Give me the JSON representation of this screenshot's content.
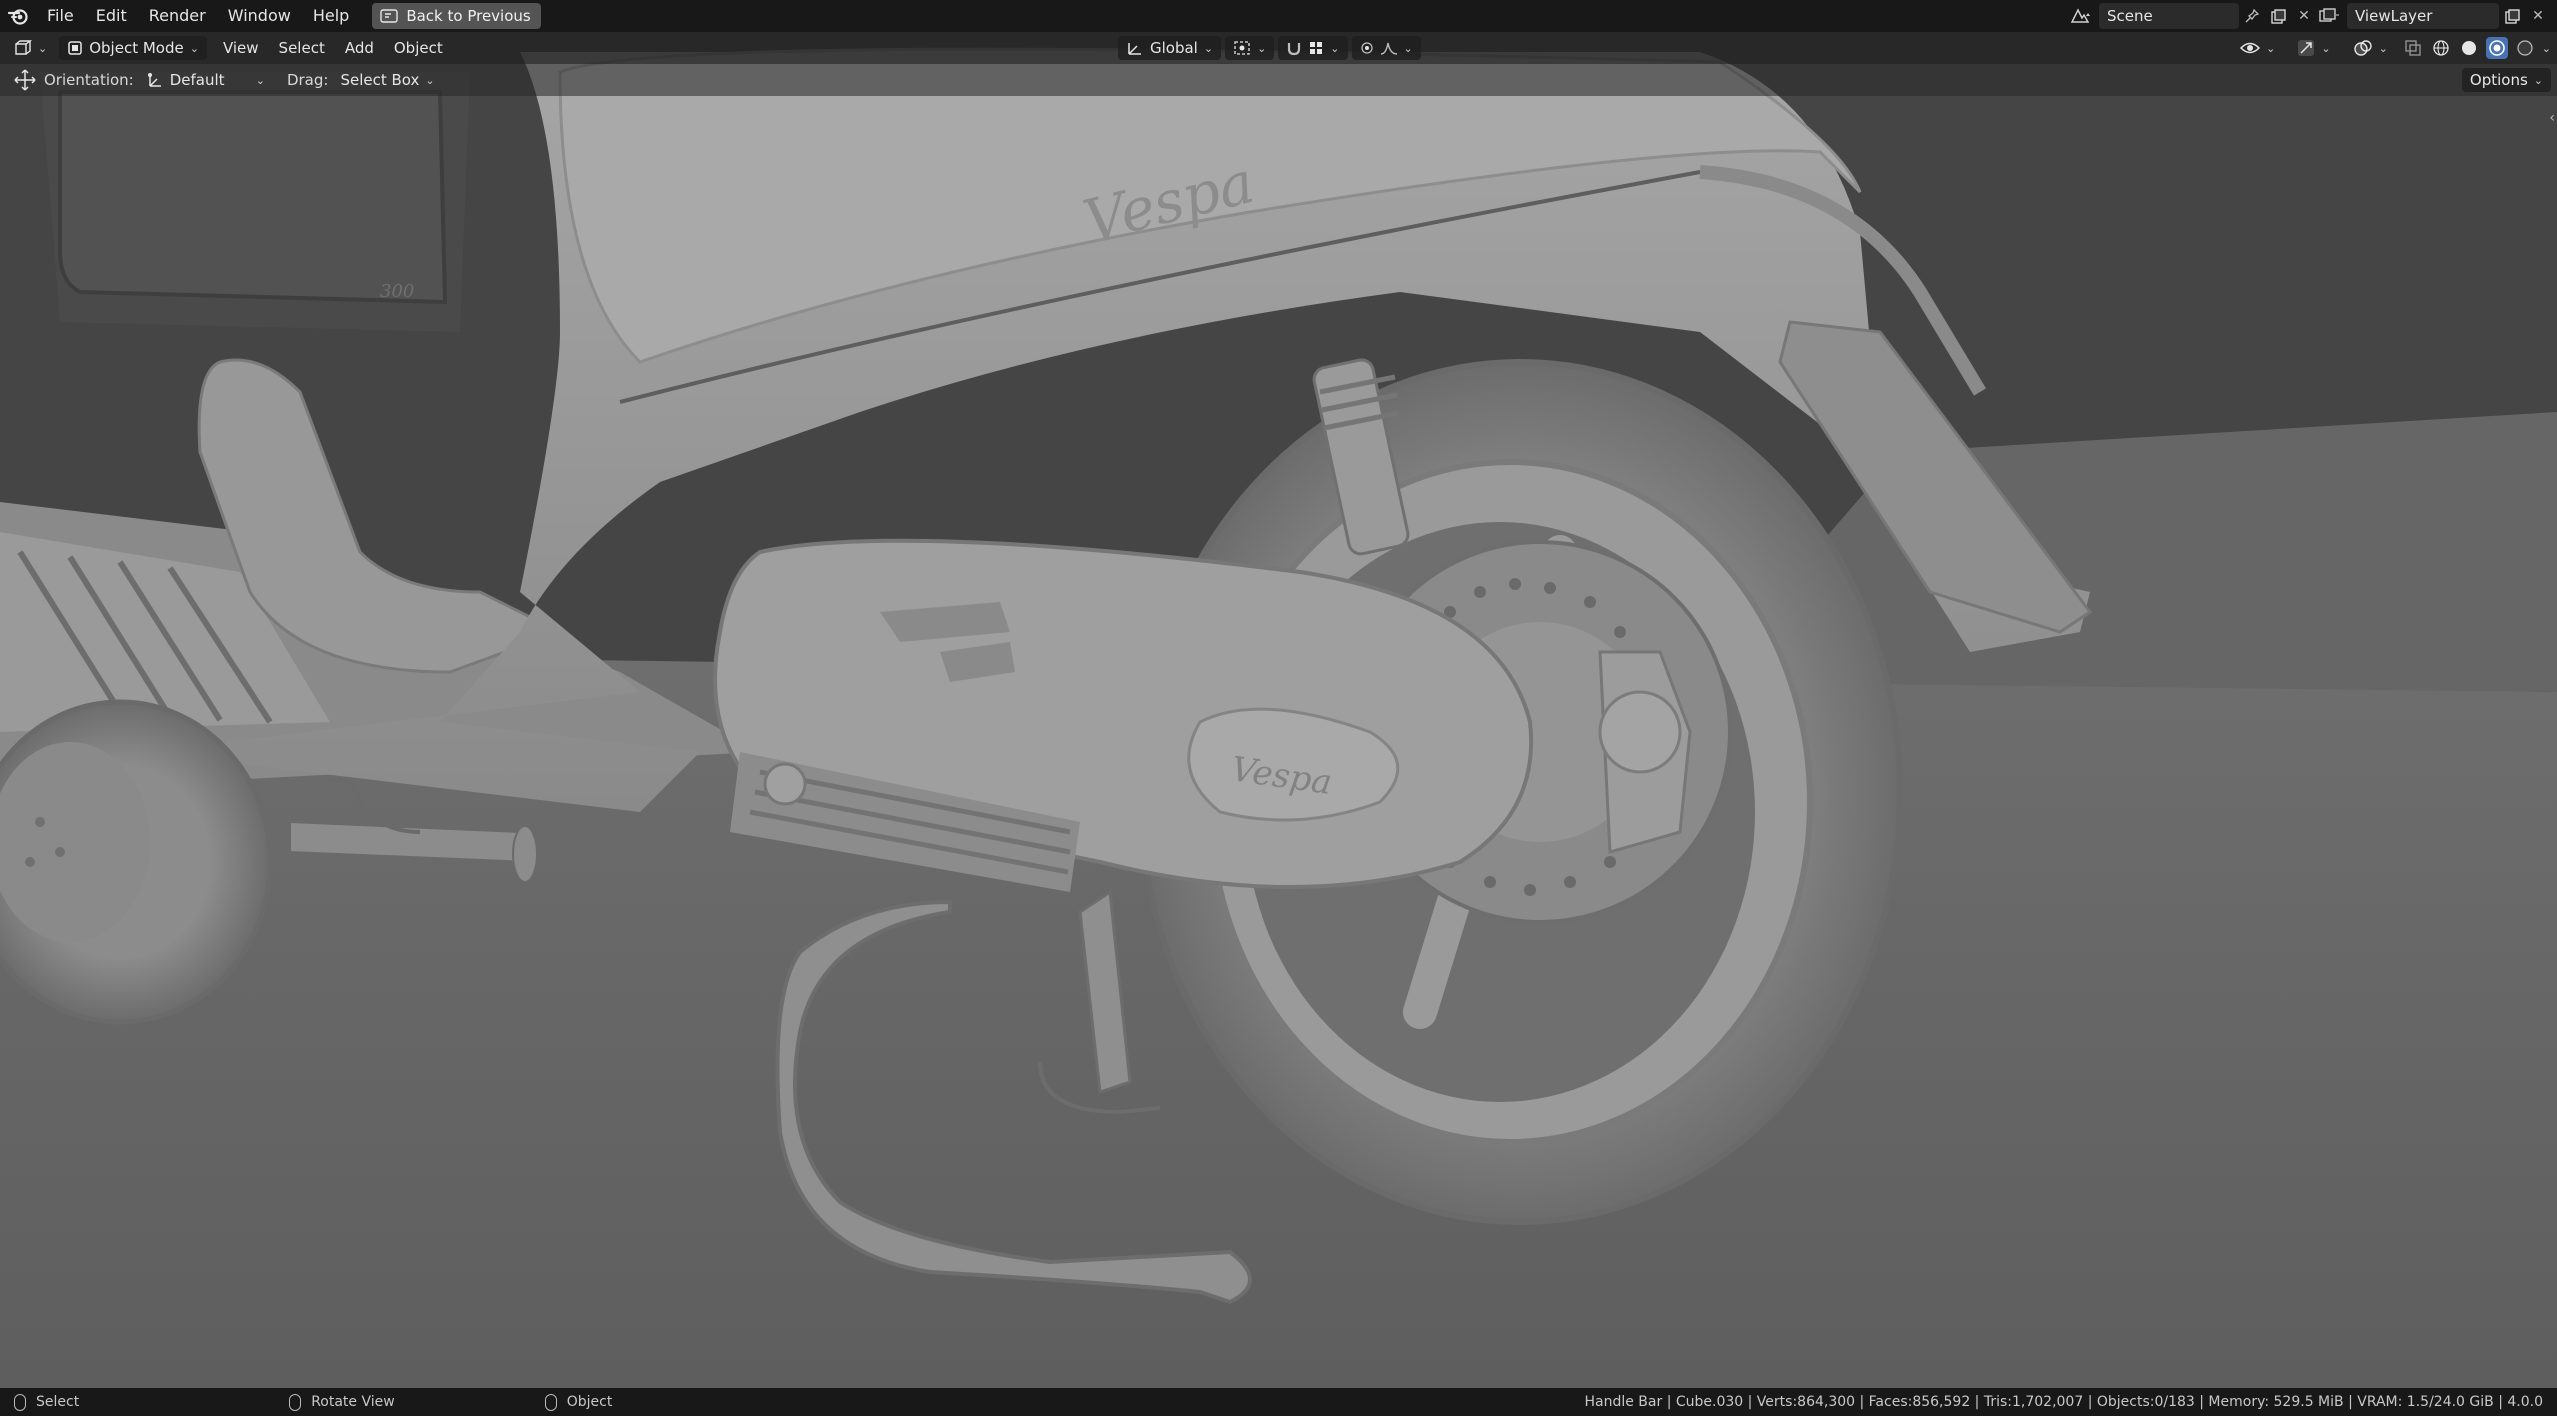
{
  "menu": {
    "items": [
      "File",
      "Edit",
      "Render",
      "Window",
      "Help"
    ],
    "back_button": "Back to Previous"
  },
  "scene": {
    "name": "Scene",
    "view_layer": "ViewLayer"
  },
  "viewport_header": {
    "mode": "Object Mode",
    "menus": [
      "View",
      "Select",
      "Add",
      "Object"
    ],
    "transform_orientation": "Global"
  },
  "tool_settings": {
    "orientation_label": "Orientation:",
    "orientation_value": "Default",
    "drag_label": "Drag:",
    "drag_value": "Select Box",
    "options_label": "Options"
  },
  "model_text": {
    "body_logo": "Vespa",
    "engine_logo": "Vespa",
    "panel_badge": "300"
  },
  "statusbar": {
    "select": "Select",
    "rotate": "Rotate View",
    "object": "Object",
    "stats": "Handle Bar | Cube.030 | Verts:864,300 | Faces:856,592 | Tris:1,702,007 | Objects:0/183 | Memory: 529.5 MiB | VRAM: 1.5/24.0 GiB | 4.0.0"
  },
  "colors": {
    "accent": "#4772b3",
    "topbar": "#181818",
    "viewport_bg": "#5b5b5b"
  }
}
